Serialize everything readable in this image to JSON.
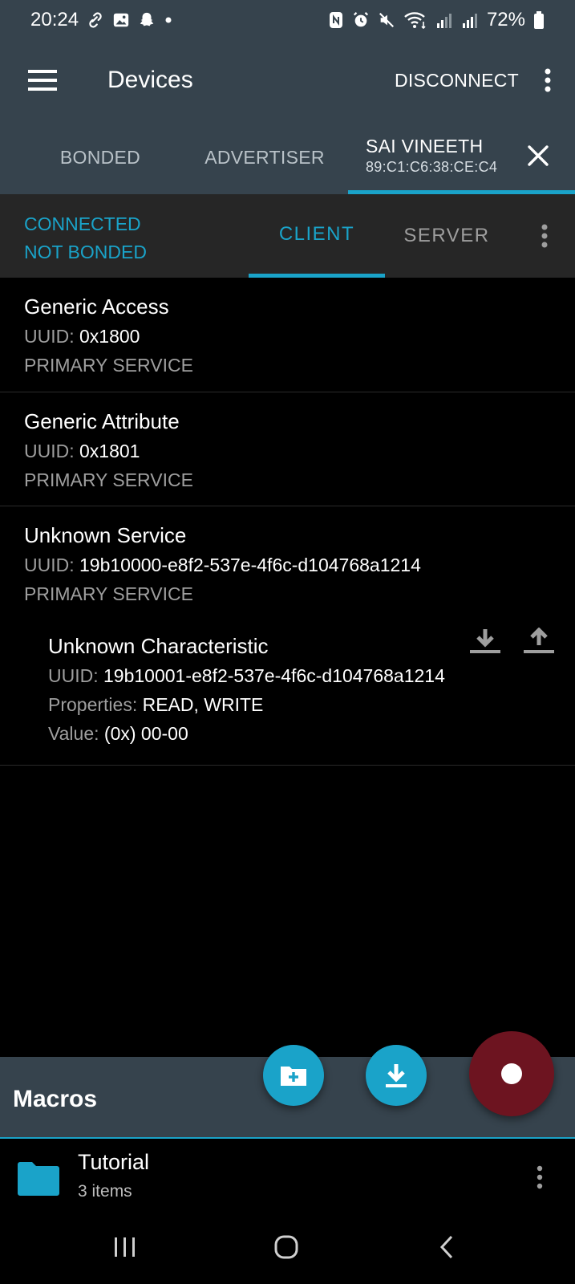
{
  "status_bar": {
    "time": "20:24",
    "battery": "72%",
    "left_icons": [
      "link-icon",
      "gallery-icon",
      "snapchat-icon",
      "dot-icon"
    ],
    "right_icons": [
      "nfc-icon",
      "alarm-icon",
      "mute-icon",
      "wifi-icon",
      "signal-icon",
      "signal-icon",
      "battery-icon"
    ]
  },
  "app_bar": {
    "title": "Devices",
    "disconnect_label": "DISCONNECT"
  },
  "device_tabs": {
    "bonded": "BONDED",
    "advertiser": "ADVERTISER",
    "device_name": "SAI VINEETH",
    "device_mac": "89:C1:C6:38:CE:C4"
  },
  "connection": {
    "status": "CONNECTED",
    "bond_state": "NOT BONDED",
    "tab_client": "CLIENT",
    "tab_server": "SERVER"
  },
  "labels": {
    "uuid": "UUID:",
    "properties": "Properties:",
    "value": "Value:"
  },
  "services": [
    {
      "name": "Generic Access",
      "uuid": "0x1800",
      "type": "PRIMARY SERVICE"
    },
    {
      "name": "Generic Attribute",
      "uuid": "0x1801",
      "type": "PRIMARY SERVICE"
    },
    {
      "name": "Unknown Service",
      "uuid": "19b10000-e8f2-537e-4f6c-d104768a1214",
      "type": "PRIMARY SERVICE"
    }
  ],
  "characteristic": {
    "name": "Unknown Characteristic",
    "uuid": "19b10001-e8f2-537e-4f6c-d104768a1214",
    "properties": "READ, WRITE",
    "value": "(0x) 00-00"
  },
  "macros": {
    "title": "Macros",
    "folder_name": "Tutorial",
    "folder_count": "3 items"
  },
  "colors": {
    "accent": "#1aa3c9",
    "toolbar": "#36434d",
    "record": "#6d1420"
  }
}
